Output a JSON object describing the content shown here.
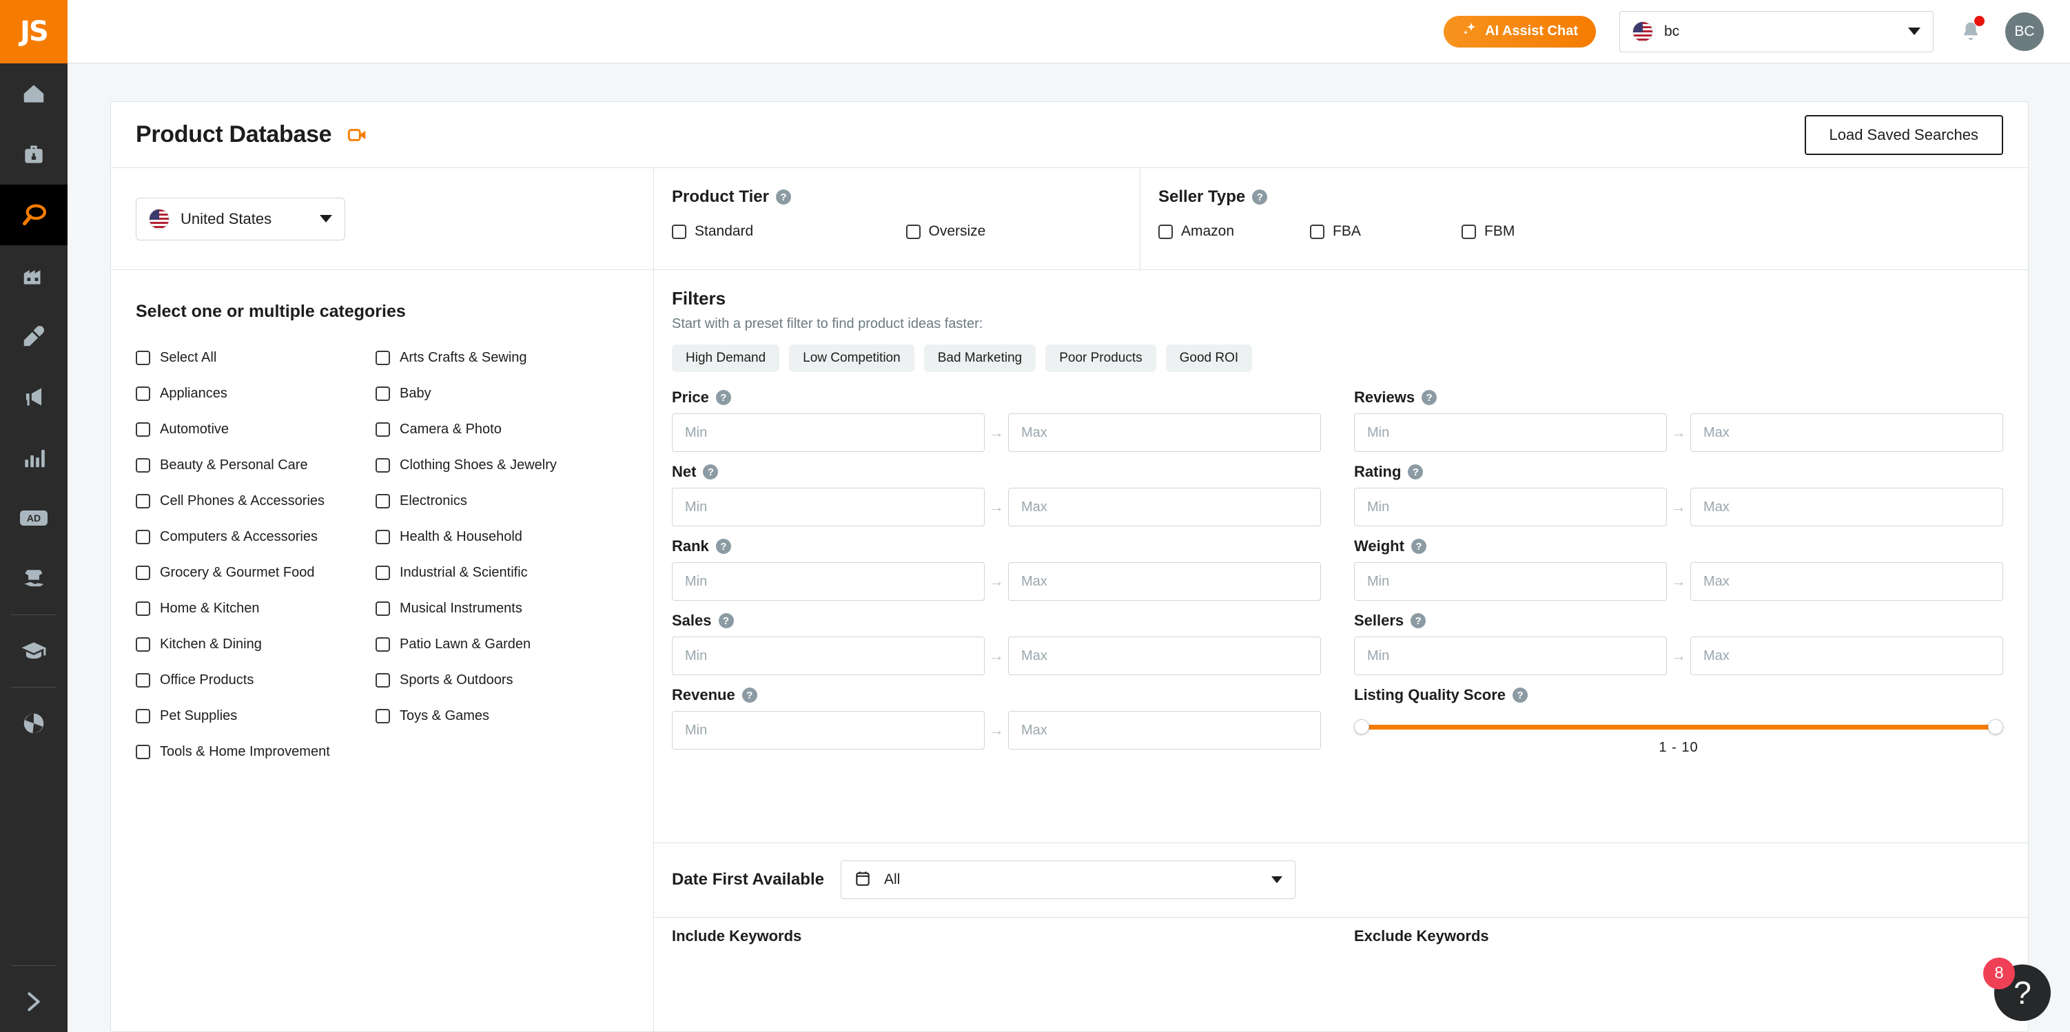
{
  "brand": {
    "logo_text": "JS",
    "accent": "#f57c00"
  },
  "sidebar": {
    "items": [
      {
        "icon": "home-icon",
        "active": false
      },
      {
        "icon": "toolbox-icon",
        "active": false
      },
      {
        "icon": "product-research-icon",
        "active": true
      },
      {
        "icon": "supplier-factory-icon",
        "active": false
      },
      {
        "icon": "keyword-icon",
        "active": false
      },
      {
        "icon": "megaphone-icon",
        "active": false
      },
      {
        "icon": "bar-chart-icon",
        "active": false
      },
      {
        "icon": "ad-badge-icon",
        "active": false
      },
      {
        "icon": "product-launch-icon",
        "active": false
      },
      {
        "icon": "academy-graduation-cap-icon",
        "active": false
      },
      {
        "icon": "pinwheel-icon",
        "active": false
      }
    ],
    "expand_icon": "chevron-right-icon"
  },
  "header": {
    "ai_assist_label": "AI Assist Chat",
    "ai_assist_icon": "sparkle-icon",
    "market_value": "bc",
    "market_flag": "us-flag-icon",
    "bell_icon": "notification-bell-icon",
    "avatar_initials": "BC"
  },
  "page": {
    "title": "Product Database",
    "video_icon": "video-camera-icon",
    "load_saved_label": "Load Saved Searches"
  },
  "country": {
    "value": "United States",
    "flag": "us-flag-icon"
  },
  "categories": {
    "heading": "Select one or multiple categories",
    "column_left": [
      "Select All",
      "Appliances",
      "Automotive",
      "Beauty & Personal Care",
      "Cell Phones & Accessories",
      "Computers & Accessories",
      "Grocery & Gourmet Food",
      "Home & Kitchen",
      "Kitchen & Dining",
      "Office Products",
      "Pet Supplies",
      "Tools & Home Improvement"
    ],
    "column_right": [
      "Arts Crafts & Sewing",
      "Baby",
      "Camera & Photo",
      "Clothing Shoes & Jewelry",
      "Electronics",
      "Health & Household",
      "Industrial & Scientific",
      "Musical Instruments",
      "Patio Lawn & Garden",
      "Sports & Outdoors",
      "Toys & Games"
    ]
  },
  "product_tier": {
    "title": "Product Tier",
    "help_icon": "help-icon",
    "options": [
      "Standard",
      "Oversize"
    ]
  },
  "seller_type": {
    "title": "Seller Type",
    "help_icon": "help-icon",
    "options": [
      "Amazon",
      "FBA",
      "FBM"
    ]
  },
  "filters": {
    "title": "Filters",
    "subtitle": "Start with a preset filter to find product ideas faster:",
    "presets": [
      "High Demand",
      "Low Competition",
      "Bad Marketing",
      "Poor Products",
      "Good ROI"
    ],
    "placeholders": {
      "min": "Min",
      "max": "Max"
    },
    "arrow_icon": "arrow-right-icon",
    "left_fields": [
      {
        "label": "Price",
        "min": "",
        "max": ""
      },
      {
        "label": "Net",
        "min": "",
        "max": ""
      },
      {
        "label": "Rank",
        "min": "",
        "max": ""
      },
      {
        "label": "Sales",
        "min": "",
        "max": ""
      },
      {
        "label": "Revenue",
        "min": "",
        "max": ""
      }
    ],
    "right_fields": [
      {
        "label": "Reviews",
        "min": "",
        "max": ""
      },
      {
        "label": "Rating",
        "min": "",
        "max": ""
      },
      {
        "label": "Weight",
        "min": "",
        "max": ""
      },
      {
        "label": "Sellers",
        "min": "",
        "max": ""
      }
    ],
    "lqs": {
      "label": "Listing Quality Score",
      "min": "1",
      "separator": "-",
      "max": "10",
      "range_text": "1  -  10",
      "track_color": "#f57c00"
    }
  },
  "date_first_available": {
    "label": "Date First Available",
    "calendar_icon": "calendar-icon",
    "value": "All"
  },
  "keywords": {
    "include_label": "Include Keywords",
    "exclude_label": "Exclude Keywords"
  },
  "help_widget": {
    "icon": "question-mark-icon",
    "badge_count": "8"
  }
}
